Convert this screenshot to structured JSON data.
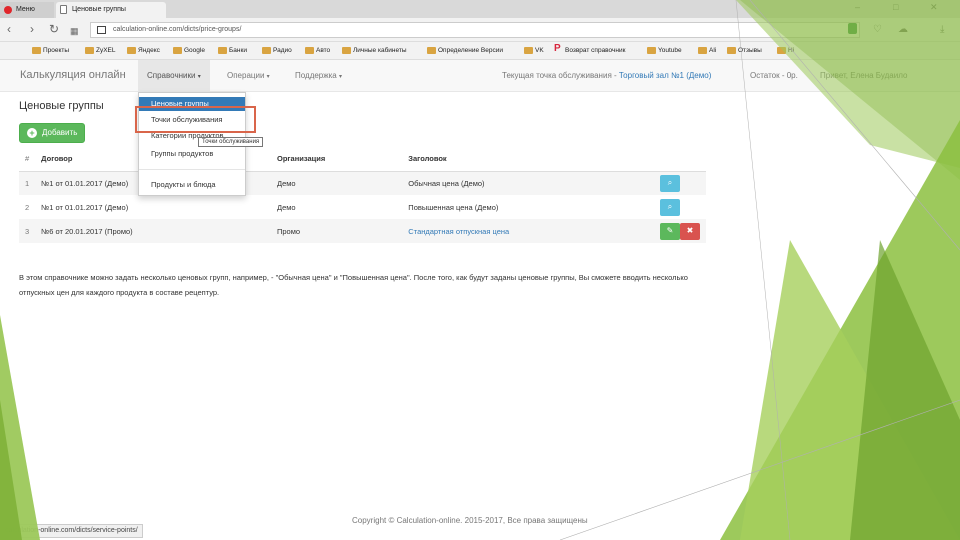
{
  "browser": {
    "tabs": [
      {
        "label": "Меню"
      },
      {
        "label": "Ценовые группы"
      }
    ],
    "url": "calculation-online.com/dicts/price-groups/",
    "bookmarks": [
      "Проекты",
      "ZyXEL",
      "Яндекс",
      "Google",
      "Банки",
      "Радио",
      "Авто",
      "Личные кабинеты",
      "Определение Версии",
      "VK",
      "Возврат справочник",
      "Youtube",
      "Ali",
      "Отзывы",
      "Ні"
    ]
  },
  "navbar": {
    "brand": "Калькуляция онлайн",
    "menu": {
      "dicts": "Справочники",
      "operations": "Операции",
      "support": "Поддержка"
    },
    "service_point_label": "Текущая точка обслуживания -",
    "service_point": "Торговый зал №1 (Демо)",
    "balance": "Остаток - 0р.",
    "greeting": "Привет,",
    "user": "Елена Будаило"
  },
  "dropdown": {
    "items": [
      "Ценовые группы",
      "Точки обслуживания",
      "Категории продуктов",
      "Группы продуктов",
      "Продукты и блюда"
    ],
    "tooltip": "Точки обслуживания"
  },
  "page": {
    "title": "Ценовые группы",
    "add_label": "Добавить",
    "table": {
      "headers": [
        "#",
        "Договор",
        "Организация",
        "Заголовок"
      ],
      "rows": [
        {
          "num": "1",
          "contract": "№1 от 01.01.2017 (Демо)",
          "org": "Демо",
          "title": "Обычная цена (Демо)",
          "link": false
        },
        {
          "num": "2",
          "contract": "№1 от 01.01.2017 (Демо)",
          "org": "Демо",
          "title": "Повышенная цена (Демо)",
          "link": false
        },
        {
          "num": "3",
          "contract": "№6 от 20.01.2017 (Промо)",
          "org": "Промо",
          "title": "Стандартная отпускная цена",
          "link": true
        }
      ]
    },
    "description": "В этом справочнике можно задать несколько ценовых групп, например, - \"Обычная цена\" и \"Повышенная цена\". После того, как будут заданы ценовые группы, Вы сможете вводить несколько отпускных цен для каждого продукта в составе рецептур."
  },
  "footer": {
    "copyright": "Copyright © Calculation-online. 2015-2017, Все права защищены"
  },
  "statusbar": {
    "url": "calculation-online.com/dicts/service-points/"
  },
  "colors": {
    "primary": "#337ab7",
    "success": "#5cb85c",
    "info": "#5bc0de",
    "danger": "#d9534f",
    "highlight": "#d9654a",
    "deco_green": "#8cbf3f"
  }
}
